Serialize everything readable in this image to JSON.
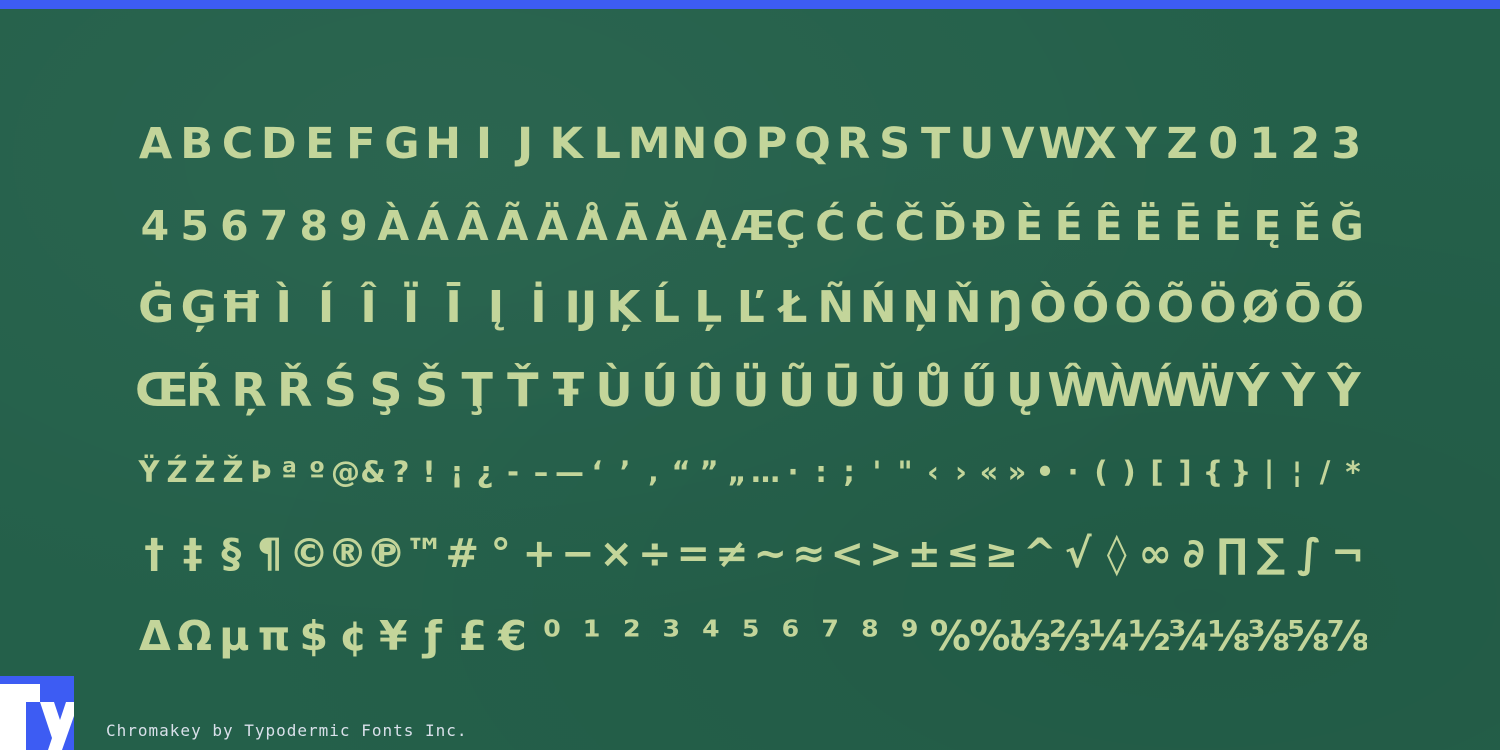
{
  "colors": {
    "background": "#24604a",
    "glyph": "#c3d59a",
    "brand_blue": "#3d5cf3",
    "credit_text": "#d9e0ea"
  },
  "glyph_rows": [
    "ABCDEFGHIJKLMNOPQRSTUVWXYZ0123",
    "456789ÀÁÂÃÄÅĀĂĄÆÇĆĊČĎĐÈÉÊËĒĖĘĚĞ",
    "ĠĢĦÌÍÎÏĪĮİĲĶĹĻĽŁÑŃŅŇŊÒÓÔÕÖØŌŐ",
    "ŒŔŖŘŚŞŠŢŤŦÙÚÛÜŨŪŬŮŰŲŴẀẂẄÝỲŶ",
    "ŸŹŻŽÞªº@&?!¡¿-–—‘’‚“”„…·:;'\"‹›«»•·()[]{}|¦/*",
    "†‡§¶©®℗™#°+−×÷=≠~≈<>±≤≥^√◊∞∂∏∑∫¬",
    "ΔΩµπ$¢¥ƒ£€⁰¹²³⁴⁵⁶⁷⁸⁹%‰⅓⅔¼½¾⅛⅜⅝⅞"
  ],
  "logo": {
    "icon": "typodermic-ty-logo-icon"
  },
  "credit": "Chromakey by Typodermic Fonts Inc."
}
